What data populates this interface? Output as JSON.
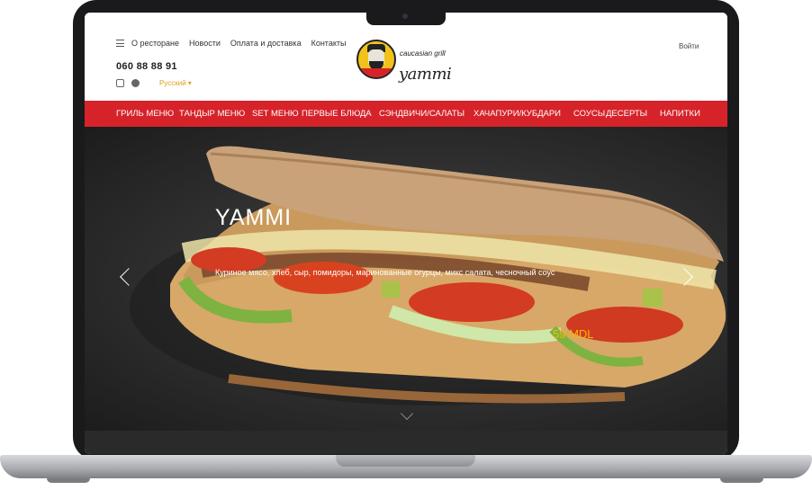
{
  "header": {
    "nav": [
      "О ресторане",
      "Новости",
      "Оплата и доставка",
      "Контакты"
    ],
    "phone": "060 88 88 91",
    "language": "Русский",
    "login": "Войти",
    "logo_tagline": "caucasian grill",
    "logo_name": "yammi"
  },
  "categories": [
    "ГРИЛЬ МЕНЮ",
    "ТАНДЫР МЕНЮ",
    "SET МЕНЮ",
    "ПЕРВЫЕ БЛЮДА",
    "СЭНДВИЧИ/САЛАТЫ",
    "ХАЧАПУРИ/КУБДАРИ",
    "СОУСЫ",
    "ДЕСЕРТЫ",
    "НАПИТКИ"
  ],
  "slide": {
    "title": "YAMMI",
    "description": "Куриное мясо, хлеб, сыр, помидоры, маринованные огурцы, микс салата, чесночный соус",
    "price": "59 MDL"
  },
  "colors": {
    "accent_red": "#d6232a",
    "logo_yellow": "#f2c21b",
    "price_gold": "#f2b705"
  },
  "icons": [
    "menu-icon",
    "instagram-icon",
    "facebook-icon",
    "chevron-left-icon",
    "chevron-right-icon",
    "chevron-down-icon"
  ]
}
